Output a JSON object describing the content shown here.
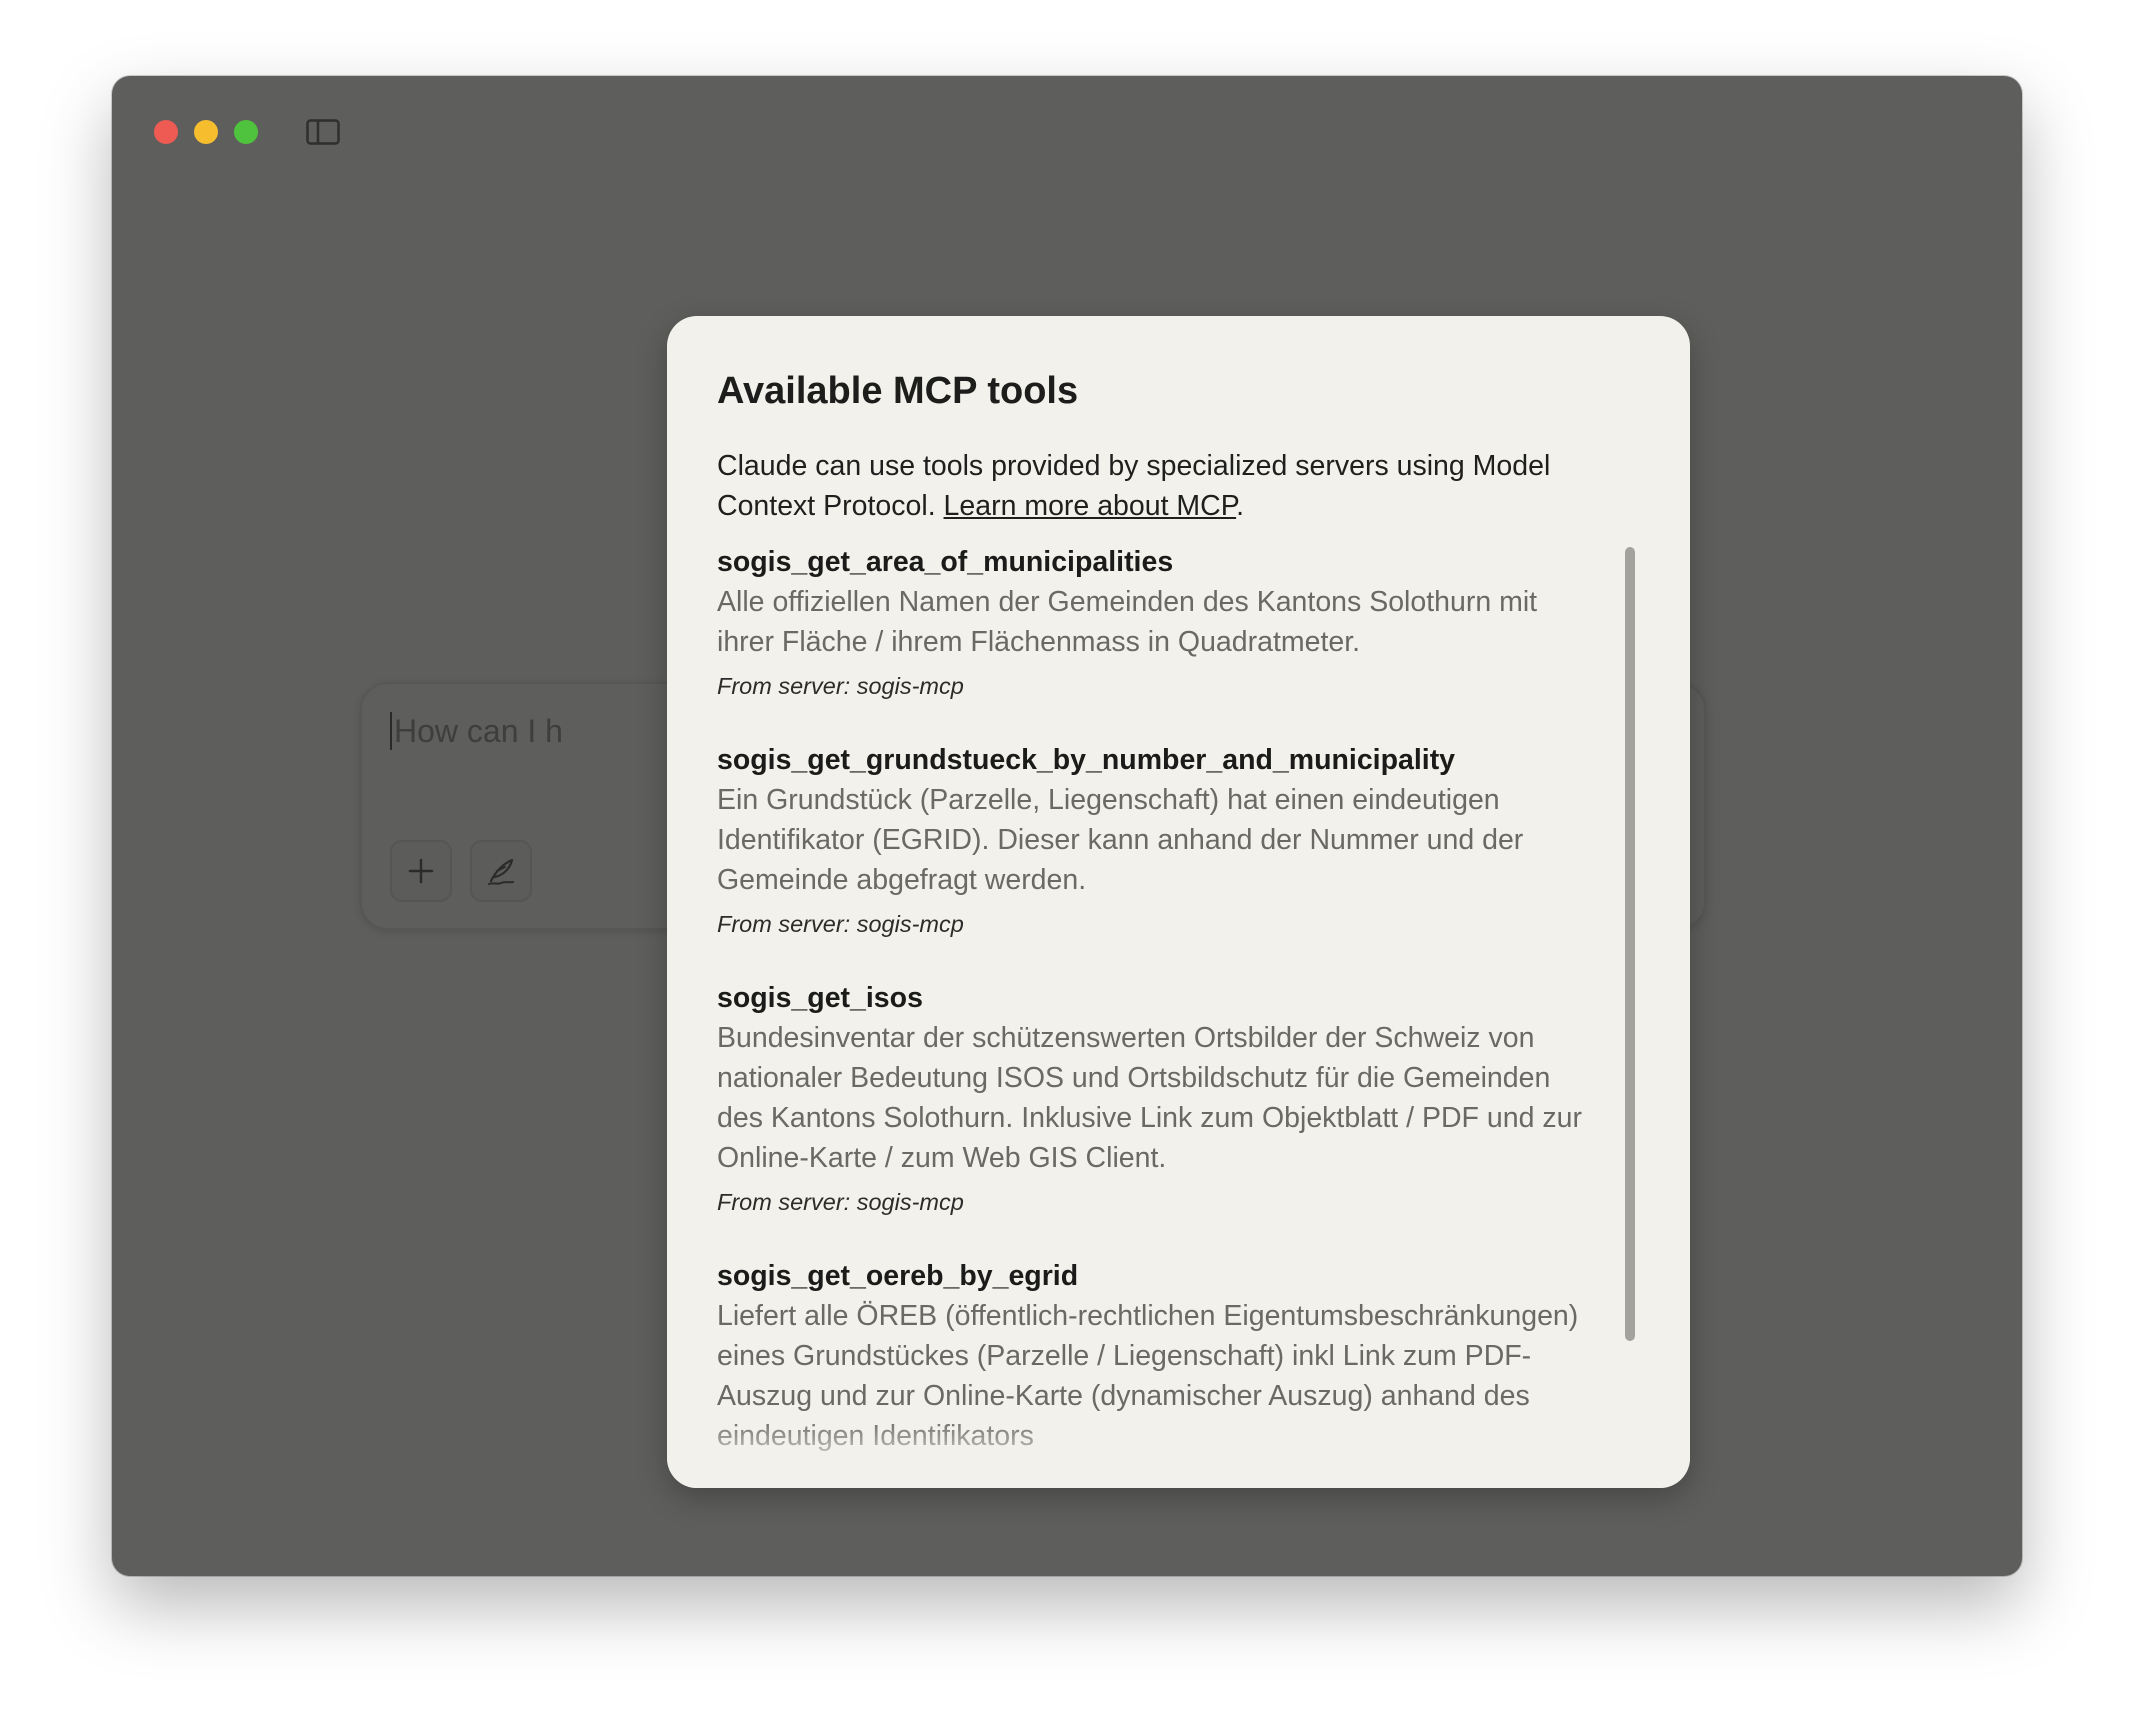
{
  "composer": {
    "placeholder_visible": "How can I h"
  },
  "modal": {
    "title": "Available MCP tools",
    "description_prefix": "Claude can use tools provided by specialized servers using Model Context Protocol. ",
    "learn_more_link": "Learn more about MCP",
    "description_suffix": "."
  },
  "tools": [
    {
      "name": "sogis_get_area_of_municipalities",
      "description": "Alle offiziellen Namen der Gemeinden des Kantons Solothurn mit ihrer Fläche / ihrem Flächenmass in Quadratmeter.",
      "server": "From server: sogis-mcp"
    },
    {
      "name": "sogis_get_grundstueck_by_number_and_municipality",
      "description": "Ein Grundstück (Parzelle, Liegenschaft) hat einen eindeutigen Identifikator (EGRID). Dieser kann anhand der Nummer und der Gemeinde abgefragt werden.",
      "server": "From server: sogis-mcp"
    },
    {
      "name": "sogis_get_isos",
      "description": "Bundesinventar der schützenswerten Ortsbilder der Schweiz von nationaler Bedeutung ISOS und Ortsbildschutz für die Gemeinden des Kantons Solothurn. Inklusive Link zum Objektblatt / PDF und zur Online-Karte / zum Web GIS Client.",
      "server": "From server: sogis-mcp"
    },
    {
      "name": "sogis_get_oereb_by_egrid",
      "description": "Liefert alle ÖREB (öffentlich-rechtlichen Eigentumsbeschränkungen) eines Grundstückes (Parzelle / Liegenschaft) inkl Link zum PDF-Auszug und zur Online-Karte (dynamischer Auszug) anhand des eindeutigen Identifikators",
      "server": ""
    }
  ],
  "colors": {
    "window_bg": "#5e5e5c",
    "modal_bg": "#f2f1eb",
    "send_button": "#6b4a3d",
    "close": "#ee5b53",
    "minimize": "#f6be2f",
    "maximize": "#4fc33d"
  },
  "icons": {
    "sidebar": "sidebar-toggle-icon",
    "plus": "plus-icon",
    "style": "feather-pen-icon",
    "send": "arrow-up-icon"
  }
}
